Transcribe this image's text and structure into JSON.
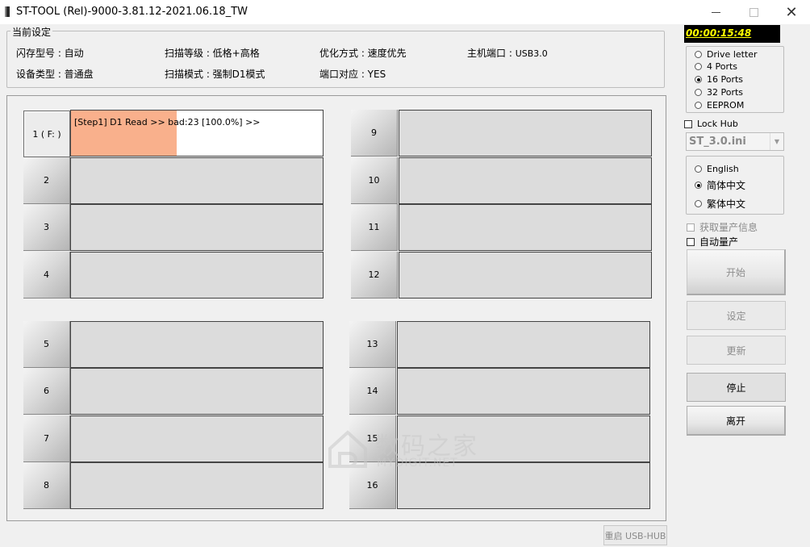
{
  "window": {
    "title": "ST-TOOL (Rel)-9000-3.81.12-2021.06.18_TW",
    "minimize": "—",
    "maximize": "☐",
    "close": "✕"
  },
  "settings": {
    "group_title": "当前设定",
    "flash_model": "闪存型号 : 自动",
    "device_type": "设备类型 : 普通盘",
    "scan_level": "扫描等级 : 低格+高格",
    "scan_mode": "扫描模式 : 强制D1模式",
    "optimize": "优化方式 : 速度优先",
    "port_map": "端口对应 : YES",
    "host_port_label": "主机端口 : ",
    "host_port_value": "USB3.0"
  },
  "ports": [
    {
      "label": "1 ( F: )",
      "status": "[Step1] D1 Read  >> bad:23  [100.0%]  >>",
      "progress": 0.42,
      "active": true
    },
    {
      "label": "2",
      "status": "",
      "active": false
    },
    {
      "label": "3",
      "status": "",
      "active": false
    },
    {
      "label": "4",
      "status": "",
      "active": false
    },
    {
      "label": "5",
      "status": "",
      "active": false
    },
    {
      "label": "6",
      "status": "",
      "active": false
    },
    {
      "label": "7",
      "status": "",
      "active": false
    },
    {
      "label": "8",
      "status": "",
      "active": false
    },
    {
      "label": "9",
      "status": "",
      "active": false
    },
    {
      "label": "10",
      "status": "",
      "active": false
    },
    {
      "label": "11",
      "status": "",
      "active": false
    },
    {
      "label": "12",
      "status": "",
      "active": false
    },
    {
      "label": "13",
      "status": "",
      "active": false
    },
    {
      "label": "14",
      "status": "",
      "active": false
    },
    {
      "label": "15",
      "status": "",
      "active": false
    },
    {
      "label": "16",
      "status": "",
      "active": false
    }
  ],
  "timer": "00:00:15:48",
  "port_mode": {
    "options": [
      "Drive letter",
      "4 Ports",
      "16 Ports",
      "32 Ports",
      "EEPROM"
    ],
    "selected": "16 Ports"
  },
  "lock_hub": "Lock Hub",
  "ini_file": "ST_3.0.ini",
  "language": {
    "options": [
      "English",
      "简体中文",
      "繁体中文"
    ],
    "selected": "简体中文"
  },
  "fetch_info": "获取量产信息",
  "auto_produce": "自动量产",
  "buttons": {
    "start": "开始",
    "settings": "设定",
    "update": "更新",
    "stop": "停止",
    "exit": "离开"
  },
  "restart_hub": "重启 USB-HUB",
  "watermark": {
    "cn": "数码之家",
    "en": "MYDIGIT.NET"
  },
  "colors": {
    "progress": "#f9b08c",
    "timer_text": "#ffff00",
    "timer_bg": "#000000"
  }
}
